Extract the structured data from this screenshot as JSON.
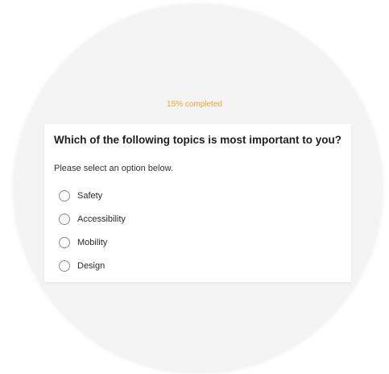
{
  "progress": {
    "label": "15% completed",
    "percent": 15,
    "color": "#f0a23a"
  },
  "question": {
    "title": "Which of the following topics is most important to you?",
    "instruction": "Please select an option below.",
    "options": [
      {
        "label": "Safety",
        "selected": false
      },
      {
        "label": "Accessibility",
        "selected": false
      },
      {
        "label": "Mobility",
        "selected": false
      },
      {
        "label": "Design",
        "selected": false
      }
    ]
  }
}
